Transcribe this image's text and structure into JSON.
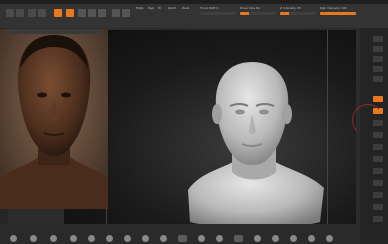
{
  "toolbar": {
    "tools": [
      {
        "icon": "brush-icon"
      },
      {
        "icon": "edit-icon",
        "active": true
      },
      {
        "icon": "draw-icon",
        "active": true
      },
      {
        "icon": "move-icon"
      },
      {
        "icon": "scale-icon"
      },
      {
        "icon": "rotate-icon"
      }
    ],
    "labels": {
      "mrgb": "Mrgb",
      "rgb": "Rgb",
      "m": "M",
      "zadd": "Zadd",
      "zsub": "Zsub",
      "focal_shift": "Focal Shift 0",
      "draw_size": "Draw Size 64",
      "z_intensity": "Z Intensity 25",
      "rgb_intensity": "Rgb Intensity 100"
    },
    "sliders": {
      "focal_shift": 0.0,
      "draw_size": 0.25,
      "z_intensity": 0.25,
      "rgb_intensity": 1.0
    }
  },
  "colors": {
    "accent": "#e8781e",
    "ui_bg": "#333333",
    "canvas_bg": "#1a1a1a",
    "clay": "#c9c9c9",
    "skin": "#5b3a27"
  },
  "viewport": {
    "reference_image": "reference-portrait",
    "model": "sculpted-head-model"
  },
  "right_shelf": [
    "bpr-icon",
    "spix-icon",
    "scroll-icon",
    "zoom-icon",
    "actual-icon",
    "aahalf-icon",
    "persp-icon",
    "floor-icon",
    "local-icon",
    "lsym-icon",
    "xyz-icon",
    "frame-icon",
    "move-icon",
    "scale-icon",
    "rotate-icon",
    "polyf-icon",
    "transp-icon",
    "solo-icon"
  ],
  "bottom_shelf": [
    "brush-1",
    "brush-2",
    "brush-3",
    "brush-4",
    "brush-5",
    "brush-6",
    "brush-7",
    "brush-8",
    "brush-9",
    "brush-10",
    "brush-11",
    "brush-12",
    "brush-13",
    "brush-14",
    "brush-15",
    "brush-16",
    "brush-17",
    "brush-18"
  ]
}
